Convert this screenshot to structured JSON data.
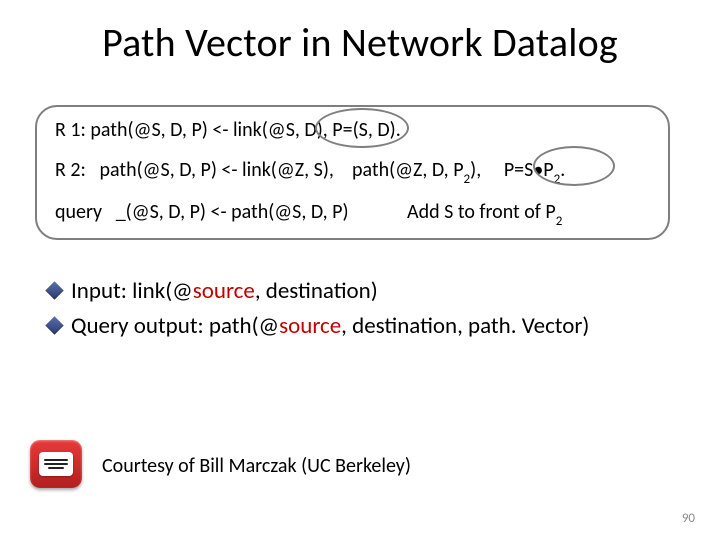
{
  "title": "Path Vector in Network Datalog",
  "rules": {
    "r1_label": "R 1:",
    "r1_body": "path(@S, D, P) <- link(@S, D), P=(S, D).",
    "r2_label": "R 2:",
    "r2_body_a": "path(@S, D, P) <- link(@Z, S),",
    "r2_body_b": "path(@Z, D, P",
    "r2_sub_b": "2",
    "r2_body_c": "),",
    "r2_body_d": "P=S",
    "r2_dot": "•",
    "r2_body_e": "P",
    "r2_sub_e": "2",
    "r2_tail": ".",
    "q_label": "query",
    "q_body": "_(@S, D, P) <- path(@S, D, P)",
    "note_a": "Add S to front of P",
    "note_sub": "2"
  },
  "bullets": {
    "b1_a": "Input: link(@",
    "b1_src": "source",
    "b1_b": ", destination)",
    "b2_a": "Query output: path(@",
    "b2_src": "source",
    "b2_b": ", destination, path. Vector)"
  },
  "courtesy": "Courtesy of Bill Marczak (UC Berkeley)",
  "pagenum": "90",
  "icons": {
    "keyboard": "keyboard-icon"
  }
}
